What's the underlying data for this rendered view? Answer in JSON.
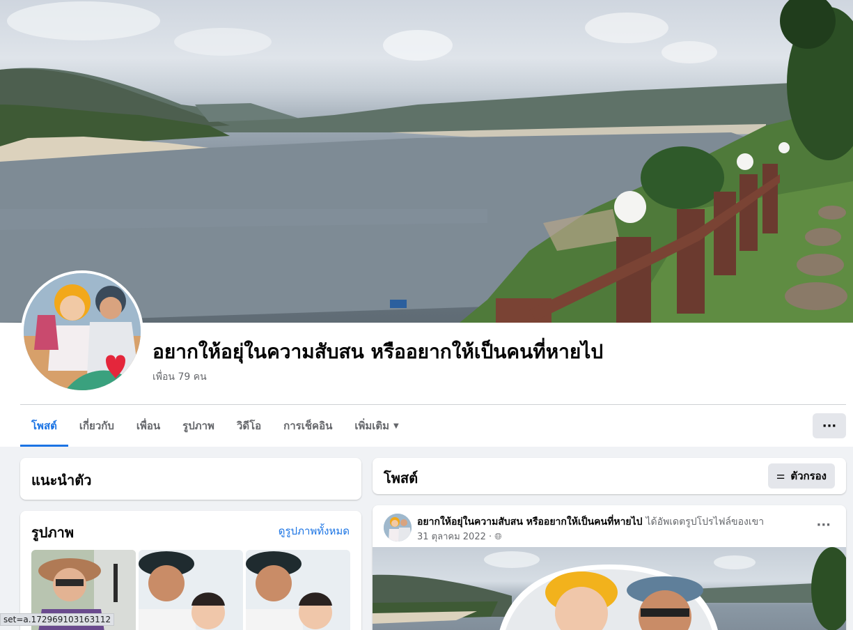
{
  "profile": {
    "name": "อยากให้อยุ่ในความสับสน หรืออยากให้เป็นคนที่หายไป",
    "friends_count": "เพื่อน 79 คน"
  },
  "tabs": [
    {
      "label": "โพสต์",
      "active": true
    },
    {
      "label": "เกี่ยวกับ",
      "active": false
    },
    {
      "label": "เพื่อน",
      "active": false
    },
    {
      "label": "รูปภาพ",
      "active": false
    },
    {
      "label": "วิดีโอ",
      "active": false
    },
    {
      "label": "การเช็คอิน",
      "active": false
    },
    {
      "label": "เพิ่มเติม",
      "active": false
    }
  ],
  "more_button": "···",
  "intro": {
    "title": "แนะนำตัว"
  },
  "photos": {
    "title": "รูปภาพ",
    "see_all": "ดูรูปภาพทั้งหมด"
  },
  "posts": {
    "title": "โพสต์",
    "filter_label": "ตัวกรอง"
  },
  "post": {
    "author": "อยากให้อยุ่ในความสับสน หรืออยากให้เป็นคนที่หายไป",
    "action": "ได้อัพเดตรูปโปรไฟล์ของเขา",
    "date": "31 ตุลาคม 2022 ·",
    "menu": "···"
  },
  "status_bar": {
    "url": "set=a.172969103163112"
  },
  "colors": {
    "accent": "#1b74e4",
    "background": "#f0f2f5",
    "secondary_text": "#65676b"
  }
}
